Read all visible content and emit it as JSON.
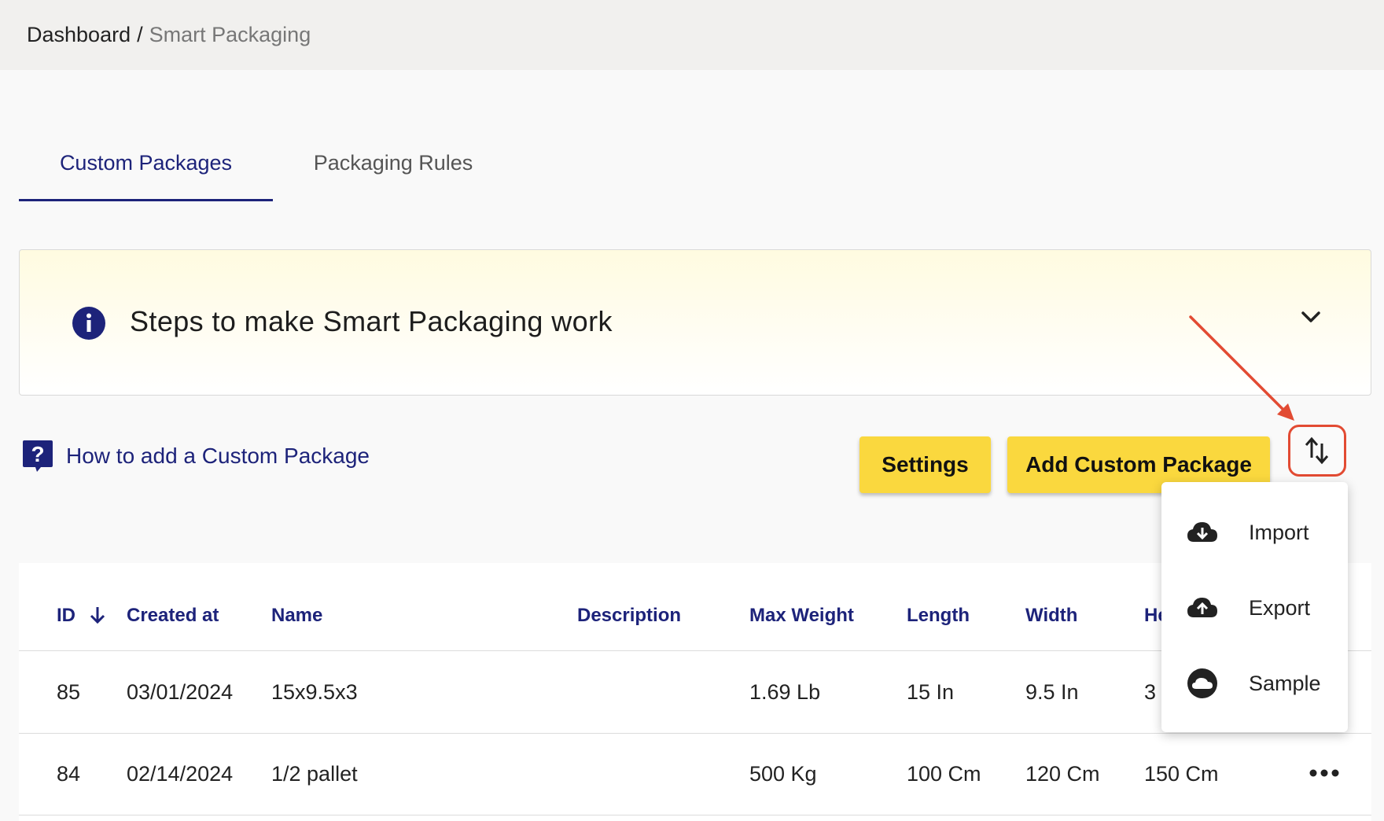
{
  "breadcrumb": {
    "root": "Dashboard",
    "separator": "/",
    "current": "Smart Packaging"
  },
  "tabs": [
    {
      "label": "Custom Packages",
      "active": true
    },
    {
      "label": "Packaging Rules",
      "active": false
    }
  ],
  "info_box": {
    "title": "Steps to make Smart Packaging work",
    "icon": "info-icon"
  },
  "help_link": {
    "label": "How to add a Custom Package",
    "icon": "question-icon"
  },
  "buttons": {
    "settings": "Settings",
    "add_custom_package": "Add Custom Package"
  },
  "import_export_menu": {
    "items": [
      {
        "label": "Import",
        "icon": "cloud-download-icon"
      },
      {
        "label": "Export",
        "icon": "cloud-upload-icon"
      },
      {
        "label": "Sample",
        "icon": "cloud-icon"
      }
    ]
  },
  "table": {
    "columns": [
      "ID",
      "Created at",
      "Name",
      "Description",
      "Max Weight",
      "Length",
      "Width",
      "He"
    ],
    "rows": [
      {
        "id": "85",
        "created_at": "03/01/2024",
        "name": "15x9.5x3",
        "description": "",
        "max_weight": "1.69 Lb",
        "length": "15 In",
        "width": "9.5 In",
        "height": "3"
      },
      {
        "id": "84",
        "created_at": "02/14/2024",
        "name": "1/2 pallet",
        "description": "",
        "max_weight": "500 Kg",
        "length": "100 Cm",
        "width": "120 Cm",
        "height": "150 Cm"
      }
    ]
  },
  "colors": {
    "primary": "#1d237a",
    "accent_yellow": "#fad83e",
    "annotation_red": "#e24b33"
  }
}
